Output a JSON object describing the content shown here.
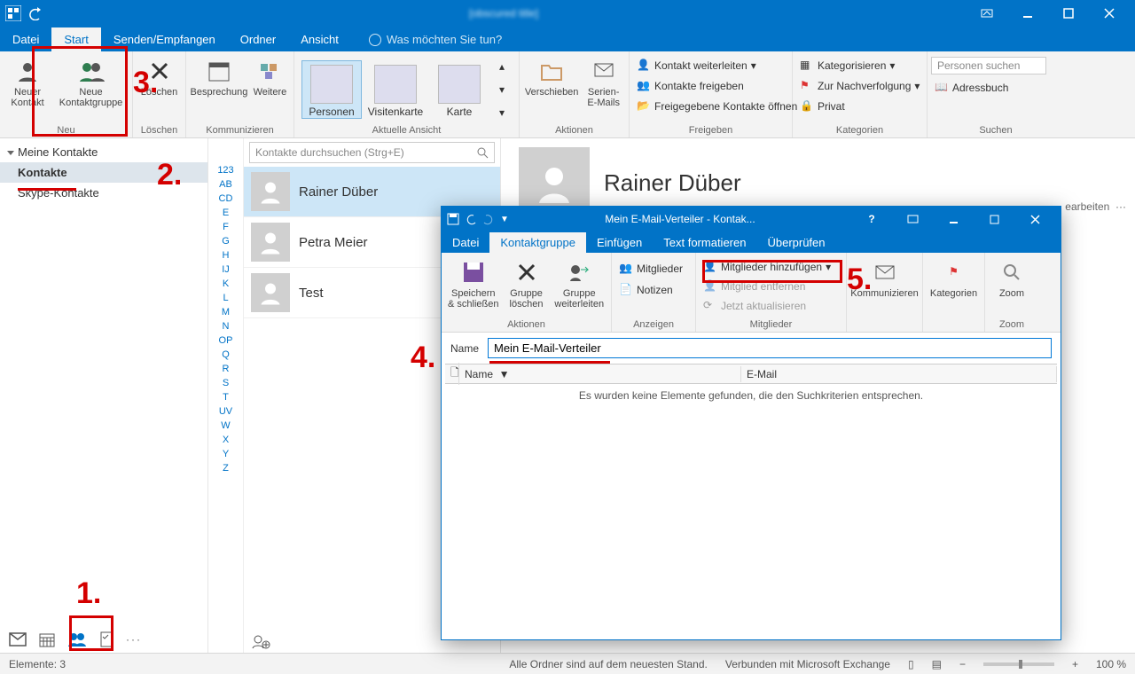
{
  "titlebar": {
    "obscured_title": "[obscured title]"
  },
  "main_tabs": {
    "datei": "Datei",
    "start": "Start",
    "senden": "Senden/Empfangen",
    "ordner": "Ordner",
    "ansicht": "Ansicht"
  },
  "tellme": "Was möchten Sie tun?",
  "ribbon": {
    "neu": {
      "neuer_kontakt": "Neuer\nKontakt",
      "neue_gruppe": "Neue\nKontaktgruppe",
      "label": "Neu"
    },
    "loeschen": {
      "btn": "Löschen",
      "label": "Löschen"
    },
    "komm": {
      "besprechung": "Besprechung",
      "weitere": "Weitere",
      "label": "Kommunizieren"
    },
    "view": {
      "personen": "Personen",
      "visitenkarte": "Visitenkarte",
      "karte": "Karte",
      "label": "Aktuelle Ansicht"
    },
    "aktionen": {
      "verschieben": "Verschieben",
      "serien": "Serien-\nE-Mails",
      "label": "Aktionen"
    },
    "freigeben": {
      "weiter": "Kontakt weiterleiten",
      "freig": "Kontakte freigeben",
      "open": "Freigegebene Kontakte öffnen",
      "label": "Freigeben"
    },
    "kat": {
      "kategorisieren": "Kategorisieren",
      "nachv": "Zur Nachverfolgung",
      "privat": "Privat",
      "label": "Kategorien"
    },
    "suchen": {
      "search_ph": "Personen suchen",
      "adressbuch": "Adressbuch",
      "label": "Suchen"
    }
  },
  "nav": {
    "hdr": "Meine Kontakte",
    "items": [
      {
        "label": "Kontakte",
        "sel": true
      },
      {
        "label": "Skype-Kontakte",
        "sel": false
      }
    ]
  },
  "alpha": [
    "123",
    "AB",
    "CD",
    "E",
    "F",
    "G",
    "H",
    "IJ",
    "K",
    "L",
    "M",
    "N",
    "OP",
    "Q",
    "R",
    "S",
    "T",
    "UV",
    "W",
    "X",
    "Y",
    "Z"
  ],
  "list": {
    "search_ph": "Kontakte durchsuchen (Strg+E)",
    "contacts": [
      {
        "name": "Rainer Düber",
        "sel": true
      },
      {
        "name": "Petra Meier",
        "sel": false
      },
      {
        "name": "Test",
        "sel": false
      }
    ]
  },
  "detail": {
    "name": "Rainer Düber",
    "edit": "earbeiten",
    "more": "···"
  },
  "child": {
    "title": "Mein E-Mail-Verteiler - Kontak...",
    "tabs": {
      "datei": "Datei",
      "kg": "Kontaktgruppe",
      "einf": "Einfügen",
      "text": "Text formatieren",
      "ueber": "Überprüfen"
    },
    "ribbon": {
      "speichern": "Speichern\n& schließen",
      "gloeschen": "Gruppe\nlöschen",
      "gweiter": "Gruppe\nweiterleiten",
      "aktionen_label": "Aktionen",
      "mitglieder_btn": "Mitglieder",
      "notizen": "Notizen",
      "anzeigen_label": "Anzeigen",
      "add": "Mitglieder hinzufügen",
      "remove": "Mitglied entfernen",
      "update": "Jetzt aktualisieren",
      "mitglieder_label": "Mitglieder",
      "komm": "Kommunizieren",
      "kat": "Kategorien",
      "zoom": "Zoom",
      "zoom_label": "Zoom"
    },
    "name_label": "Name",
    "name_value": "Mein E-Mail-Verteiler",
    "col_name": "Name",
    "col_email": "E-Mail",
    "empty": "Es wurden keine Elemente gefunden, die den Suchkriterien entsprechen."
  },
  "status": {
    "elemente": "Elemente: 3",
    "sync": "Alle Ordner sind auf dem neuesten Stand.",
    "conn": "Verbunden mit Microsoft Exchange",
    "zoom": "100 %"
  },
  "anno": {
    "n1": "1.",
    "n2": "2.",
    "n3": "3.",
    "n4": "4.",
    "n5": "5."
  }
}
